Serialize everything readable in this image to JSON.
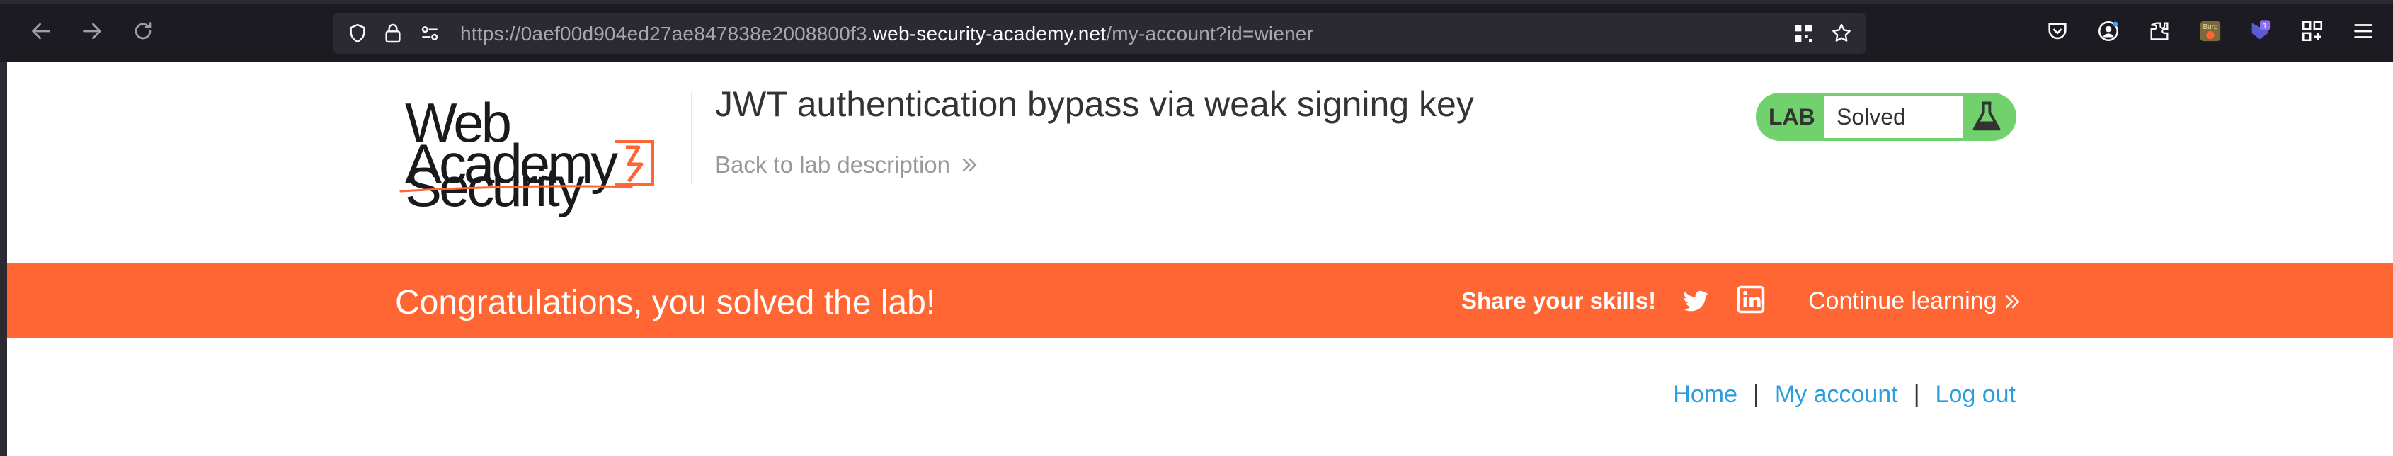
{
  "browser": {
    "url_prefix": "https://0aef00d904ed27ae847838e2008800f3.",
    "url_domain": "web-security-academy.net",
    "url_path": "/my-account?id=wiener",
    "extension_badge": "1",
    "burp_label": "Burp"
  },
  "header": {
    "logo_line1": "Web Security",
    "logo_line2": "Academy",
    "lab_title": "JWT authentication bypass via weak signing key",
    "back_link": "Back to lab description"
  },
  "lab_status": {
    "label": "LAB",
    "status": "Solved",
    "color": "#70d16d"
  },
  "banner": {
    "message": "Congratulations, you solved the lab!",
    "share_label": "Share your skills!",
    "continue_label": "Continue learning",
    "color": "#ff6633"
  },
  "nav_links": {
    "home": "Home",
    "my_account": "My account",
    "logout": "Log out",
    "separator": "|"
  },
  "colors": {
    "link": "#2b9fdd",
    "chrome_bg": "#1c1b22"
  }
}
